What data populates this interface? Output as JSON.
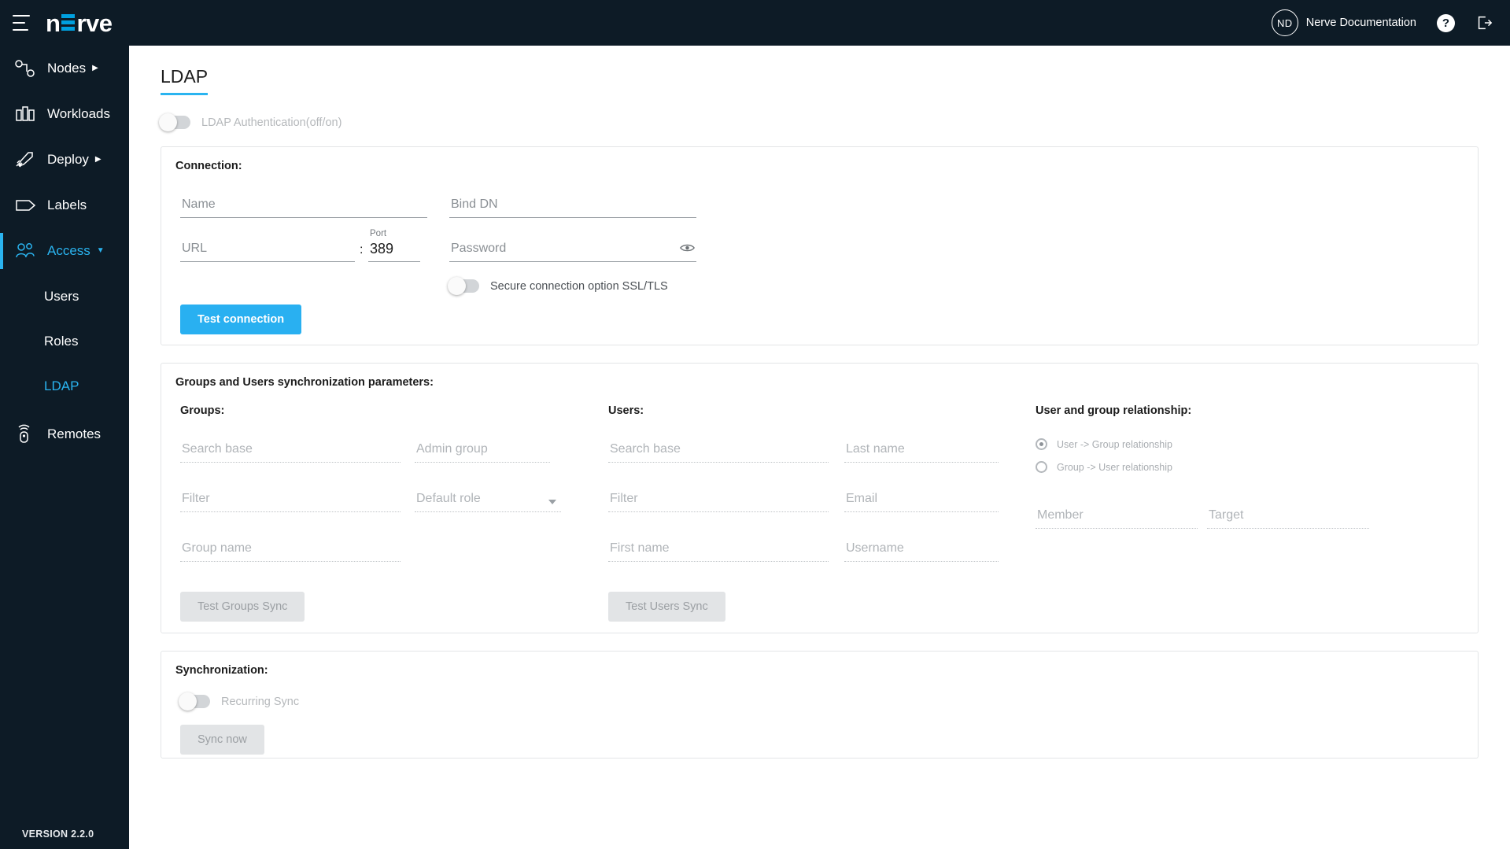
{
  "header": {
    "logo_text_pre": "n",
    "logo_text_post": "rve",
    "menu_icon": "hamburger-icon",
    "user_initials": "ND",
    "user_name": "Nerve Documentation",
    "help_icon": "?",
    "logout_icon": "logout-icon"
  },
  "sidebar": {
    "items": [
      {
        "label": "Nodes",
        "icon": "nodes-icon",
        "has_caret": true,
        "active": false
      },
      {
        "label": "Workloads",
        "icon": "workloads-icon",
        "has_caret": false,
        "active": false
      },
      {
        "label": "Deploy",
        "icon": "deploy-icon",
        "has_caret": true,
        "active": false
      },
      {
        "label": "Labels",
        "icon": "labels-icon",
        "has_caret": false,
        "active": false
      },
      {
        "label": "Access",
        "icon": "access-icon",
        "has_caret": true,
        "active": true
      }
    ],
    "subitems": [
      {
        "label": "Users",
        "active": false
      },
      {
        "label": "Roles",
        "active": false
      },
      {
        "label": "LDAP",
        "active": true
      }
    ],
    "remotes": {
      "label": "Remotes",
      "icon": "remotes-icon"
    },
    "version": "VERSION 2.2.0"
  },
  "page": {
    "title": "LDAP",
    "ldap_auth_toggle": {
      "label": "LDAP Authentication(off/on)",
      "state": "off"
    }
  },
  "connection": {
    "title": "Connection:",
    "fields": {
      "name": {
        "placeholder": "Name",
        "value": ""
      },
      "bind_dn": {
        "placeholder": "Bind DN",
        "value": ""
      },
      "url": {
        "placeholder": "URL",
        "value": ""
      },
      "port": {
        "label": "Port",
        "value": "389"
      },
      "password": {
        "placeholder": "Password",
        "value": "",
        "reveal_icon": "eye-icon"
      }
    },
    "separator": ":",
    "ssl_toggle": {
      "label": "Secure connection option SSL/TLS",
      "state": "off"
    },
    "test_button": "Test connection"
  },
  "sync_params": {
    "title": "Groups and Users synchronization parameters:",
    "groups": {
      "title": "Groups:",
      "fields": [
        {
          "placeholder": "Search base",
          "value": ""
        },
        {
          "placeholder": "Admin group",
          "value": ""
        },
        {
          "placeholder": "Filter",
          "value": ""
        },
        {
          "placeholder": "Default role",
          "value": "",
          "type": "select"
        },
        {
          "placeholder": "Group name",
          "value": ""
        }
      ],
      "test_button": "Test Groups Sync"
    },
    "users": {
      "title": "Users:",
      "fields": [
        {
          "placeholder": "Search base",
          "value": ""
        },
        {
          "placeholder": "Last name",
          "value": ""
        },
        {
          "placeholder": "Filter",
          "value": ""
        },
        {
          "placeholder": "Email",
          "value": ""
        },
        {
          "placeholder": "First name",
          "value": ""
        },
        {
          "placeholder": "Username",
          "value": ""
        }
      ],
      "test_button": "Test Users Sync"
    },
    "relationship": {
      "title": "User and group relationship:",
      "options": [
        {
          "label": "User -> Group relationship",
          "selected": true
        },
        {
          "label": "Group -> User relationship",
          "selected": false
        }
      ],
      "fields": [
        {
          "placeholder": "Member",
          "value": ""
        },
        {
          "placeholder": "Target",
          "value": ""
        }
      ]
    }
  },
  "synchronization": {
    "title": "Synchronization:",
    "recurring_toggle": {
      "label": "Recurring Sync",
      "state": "off"
    },
    "sync_button": "Sync now"
  },
  "colors": {
    "accent": "#2ab4f0",
    "primary_button": "#29b0f1",
    "sidebar_bg": "#0d1b26",
    "topbar_bg": "#0d1b26"
  }
}
